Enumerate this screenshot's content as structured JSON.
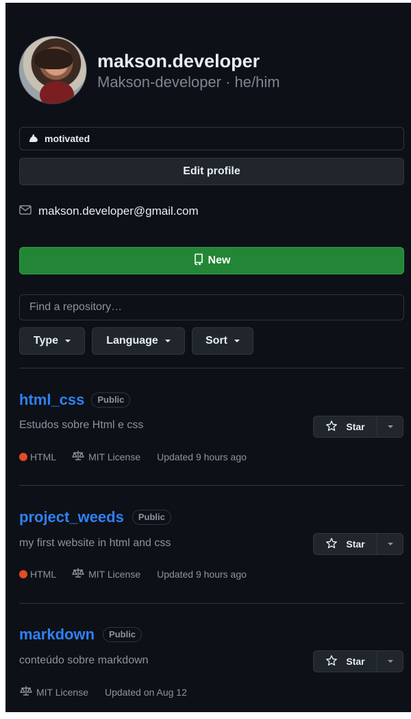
{
  "profile": {
    "username": "makson.developer",
    "subtitle": "Makson-developer · he/him",
    "status": "motivated",
    "edit_label": "Edit profile",
    "email": "makson.developer@gmail.com"
  },
  "repos_toolbar": {
    "new_label": "New",
    "search_placeholder": "Find a repository…",
    "filters": [
      "Type",
      "Language",
      "Sort"
    ]
  },
  "repositories": [
    {
      "name": "html_css",
      "visibility": "Public",
      "description": "Estudos sobre Html e css",
      "language": "HTML",
      "language_color": "#e34c26",
      "license": "MIT License",
      "updated": "Updated 9 hours ago",
      "star_label": "Star"
    },
    {
      "name": "project_weeds",
      "visibility": "Public",
      "description": "my first website in html and css",
      "language": "HTML",
      "language_color": "#e34c26",
      "license": "MIT License",
      "updated": "Updated 9 hours ago",
      "star_label": "Star"
    },
    {
      "name": "markdown",
      "visibility": "Public",
      "description": "conteúdo sobre markdown",
      "license": "MIT License",
      "updated": "Updated on Aug 12",
      "star_label": "Star"
    }
  ],
  "colors": {
    "background": "#0d1117",
    "accent": "#2f81f7",
    "new_button": "#238636"
  }
}
